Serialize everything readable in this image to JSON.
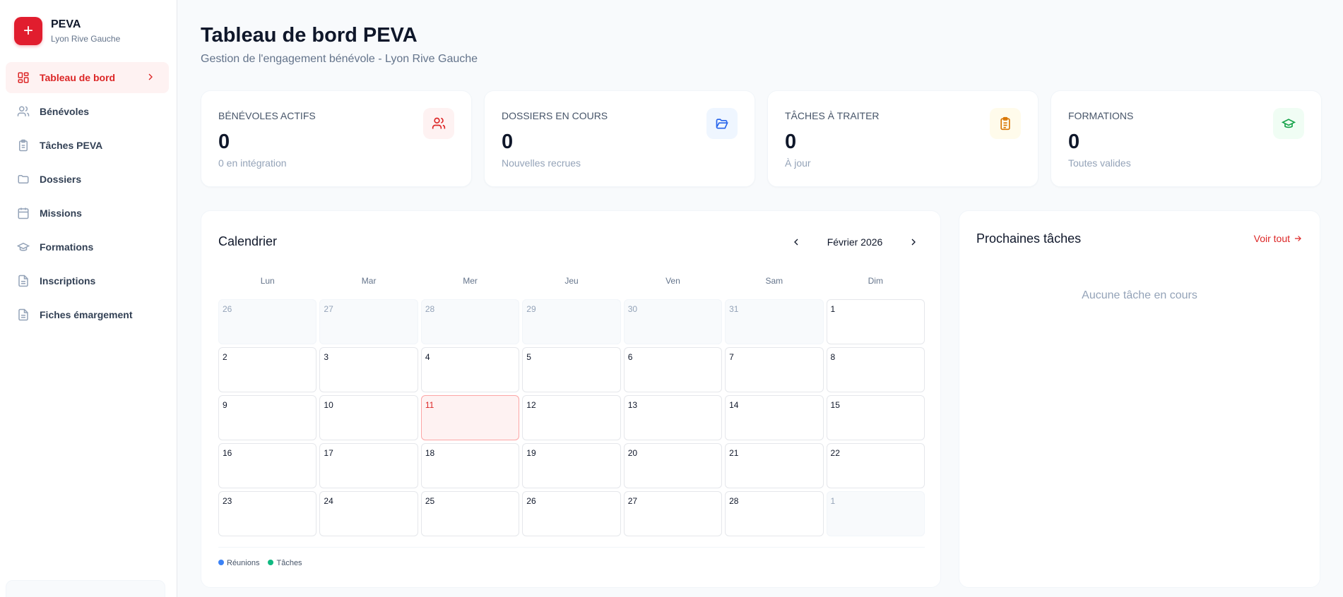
{
  "brand": {
    "name": "PEVA",
    "subtitle": "Lyon Rive Gauche"
  },
  "sidebar": {
    "items": [
      {
        "label": "Tableau de bord",
        "icon": "dashboard-icon",
        "active": true
      },
      {
        "label": "Bénévoles",
        "icon": "users-icon"
      },
      {
        "label": "Tâches PEVA",
        "icon": "clipboard-icon"
      },
      {
        "label": "Dossiers",
        "icon": "folder-icon"
      },
      {
        "label": "Missions",
        "icon": "calendar-icon"
      },
      {
        "label": "Formations",
        "icon": "graduation-cap-icon"
      },
      {
        "label": "Inscriptions",
        "icon": "file-icon"
      },
      {
        "label": "Fiches émargement",
        "icon": "file-icon"
      }
    ]
  },
  "header": {
    "title": "Tableau de bord PEVA",
    "subtitle": "Gestion de l'engagement bénévole - Lyon Rive Gauche"
  },
  "stats": [
    {
      "label": "BÉNÉVOLES ACTIFS",
      "value": "0",
      "sub": "0 en intégration",
      "icon": "users-icon",
      "color": "#dc2626",
      "bg": "#fef2f2"
    },
    {
      "label": "DOSSIERS EN COURS",
      "value": "0",
      "sub": "Nouvelles recrues",
      "icon": "folder-open-icon",
      "color": "#2563eb",
      "bg": "#eff6ff"
    },
    {
      "label": "TÂCHES À TRAITER",
      "value": "0",
      "sub": "À jour",
      "icon": "clipboard-list-icon",
      "color": "#d97706",
      "bg": "#fffbeb"
    },
    {
      "label": "FORMATIONS",
      "value": "0",
      "sub": "Toutes valides",
      "icon": "graduation-cap-icon",
      "color": "#16a34a",
      "bg": "#f0fdf4"
    }
  ],
  "calendar": {
    "title": "Calendrier",
    "month": "Février 2026",
    "weekdays": [
      "Lun",
      "Mar",
      "Mer",
      "Jeu",
      "Ven",
      "Sam",
      "Dim"
    ],
    "days": [
      {
        "d": "26",
        "out": true
      },
      {
        "d": "27",
        "out": true
      },
      {
        "d": "28",
        "out": true
      },
      {
        "d": "29",
        "out": true
      },
      {
        "d": "30",
        "out": true
      },
      {
        "d": "31",
        "out": true
      },
      {
        "d": "1"
      },
      {
        "d": "2"
      },
      {
        "d": "3"
      },
      {
        "d": "4"
      },
      {
        "d": "5"
      },
      {
        "d": "6"
      },
      {
        "d": "7"
      },
      {
        "d": "8"
      },
      {
        "d": "9"
      },
      {
        "d": "10"
      },
      {
        "d": "11",
        "today": true
      },
      {
        "d": "12"
      },
      {
        "d": "13"
      },
      {
        "d": "14"
      },
      {
        "d": "15"
      },
      {
        "d": "16"
      },
      {
        "d": "17"
      },
      {
        "d": "18"
      },
      {
        "d": "19"
      },
      {
        "d": "20"
      },
      {
        "d": "21"
      },
      {
        "d": "22"
      },
      {
        "d": "23"
      },
      {
        "d": "24"
      },
      {
        "d": "25"
      },
      {
        "d": "26"
      },
      {
        "d": "27"
      },
      {
        "d": "28"
      },
      {
        "d": "1",
        "out": true
      }
    ],
    "legend": [
      {
        "label": "Réunions",
        "color": "#3b82f6"
      },
      {
        "label": "Tâches",
        "color": "#10b981"
      }
    ]
  },
  "tasks": {
    "title": "Prochaines tâches",
    "link": "Voir tout",
    "empty": "Aucune tâche en cours"
  }
}
